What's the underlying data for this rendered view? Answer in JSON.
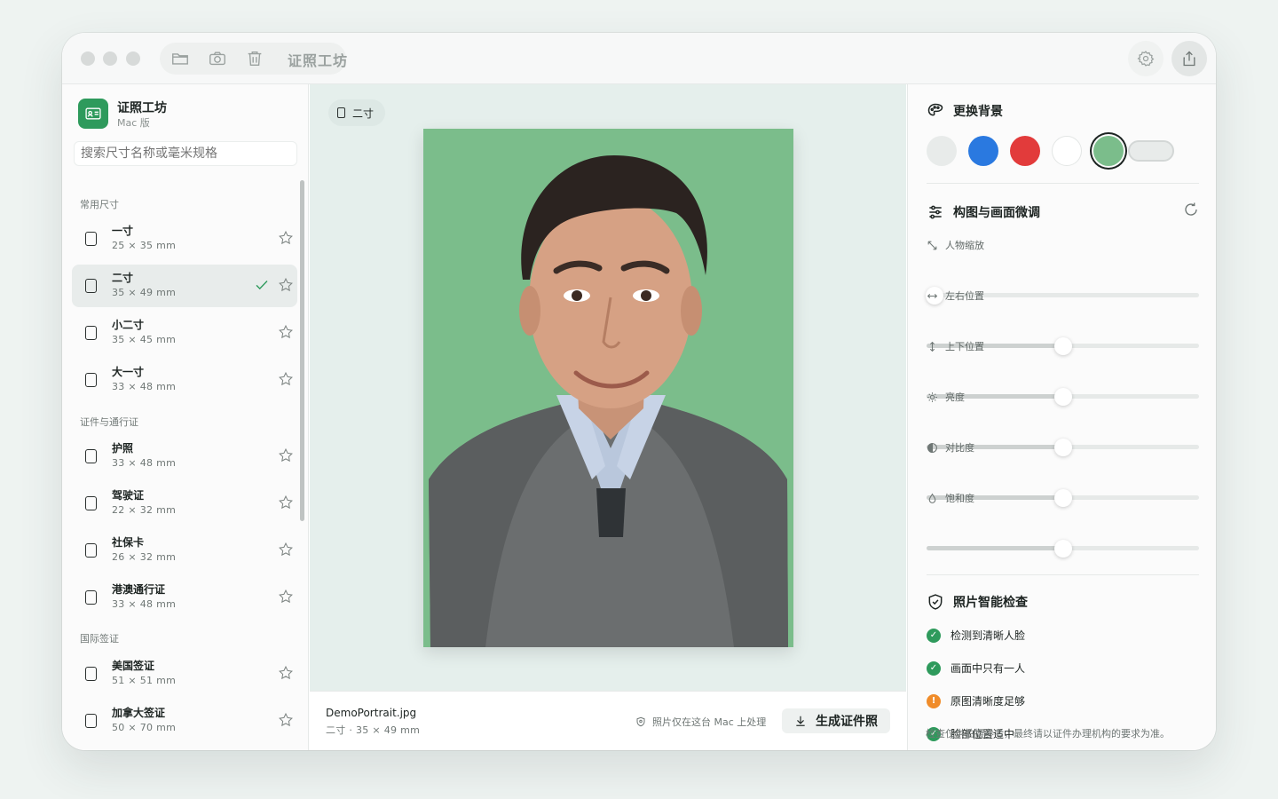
{
  "window": {
    "title": "证照工坊"
  },
  "sidebar": {
    "app_name": "证照工坊",
    "app_sub": "Mac 版",
    "search_placeholder": "搜索尺寸名称或毫米规格",
    "sections": [
      {
        "title": "常用尺寸",
        "items": [
          {
            "name": "一寸",
            "dims": "25 × 35 mm",
            "selected": false
          },
          {
            "name": "二寸",
            "dims": "35 × 49 mm",
            "selected": true
          },
          {
            "name": "小二寸",
            "dims": "35 × 45 mm",
            "selected": false
          },
          {
            "name": "大一寸",
            "dims": "33 × 48 mm",
            "selected": false
          }
        ]
      },
      {
        "title": "证件与通行证",
        "items": [
          {
            "name": "护照",
            "dims": "33 × 48 mm",
            "selected": false
          },
          {
            "name": "驾驶证",
            "dims": "22 × 32 mm",
            "selected": false
          },
          {
            "name": "社保卡",
            "dims": "26 × 32 mm",
            "selected": false
          },
          {
            "name": "港澳通行证",
            "dims": "33 × 48 mm",
            "selected": false
          }
        ]
      },
      {
        "title": "国际签证",
        "items": [
          {
            "name": "美国签证",
            "dims": "51 × 51 mm",
            "selected": false
          },
          {
            "name": "加拿大签证",
            "dims": "50 × 70 mm",
            "selected": false
          }
        ]
      }
    ]
  },
  "center": {
    "size_chip": "二寸",
    "background_color": "#7bbd8b",
    "file_name": "DemoPortrait.jpg",
    "file_meta": "二寸 · 35 × 49 mm",
    "privacy_note": "照片仅在这台 Mac 上处理",
    "generate_label": "生成证件照"
  },
  "right": {
    "bg_title": "更换背景",
    "swatches": [
      {
        "color": "#e8ebea",
        "selected": false
      },
      {
        "color": "#2a79e0",
        "selected": false
      },
      {
        "color": "#e23b3b",
        "selected": false
      },
      {
        "color": "#ffffff",
        "selected": false
      },
      {
        "color": "#7bbd8b",
        "selected": true
      }
    ],
    "adjust_title": "构图与画面微调",
    "sliders": [
      {
        "label": "人物缩放",
        "icon": "resize-icon",
        "value": 0.03
      },
      {
        "label": "左右位置",
        "icon": "horizontal-arrows-icon",
        "value": 0.5
      },
      {
        "label": "上下位置",
        "icon": "vertical-arrows-icon",
        "value": 0.5
      },
      {
        "label": "亮度",
        "icon": "sun-icon",
        "value": 0.5
      },
      {
        "label": "对比度",
        "icon": "contrast-icon",
        "value": 0.5
      },
      {
        "label": "饱和度",
        "icon": "drop-icon",
        "value": 0.5
      }
    ],
    "check_title": "照片智能检查",
    "checks": [
      {
        "label": "检测到清晰人脸",
        "status": "ok"
      },
      {
        "label": "画面中只有一人",
        "status": "ok"
      },
      {
        "label": "原图清晰度足够",
        "status": "warn"
      },
      {
        "label": "脸部位置适中",
        "status": "ok"
      }
    ],
    "disclaimer": "检查仅供拍摄参考，最终请以证件办理机构的要求为准。",
    "status_colors": {
      "ok": "#2e9a5c",
      "warn": "#f08c2a"
    }
  }
}
